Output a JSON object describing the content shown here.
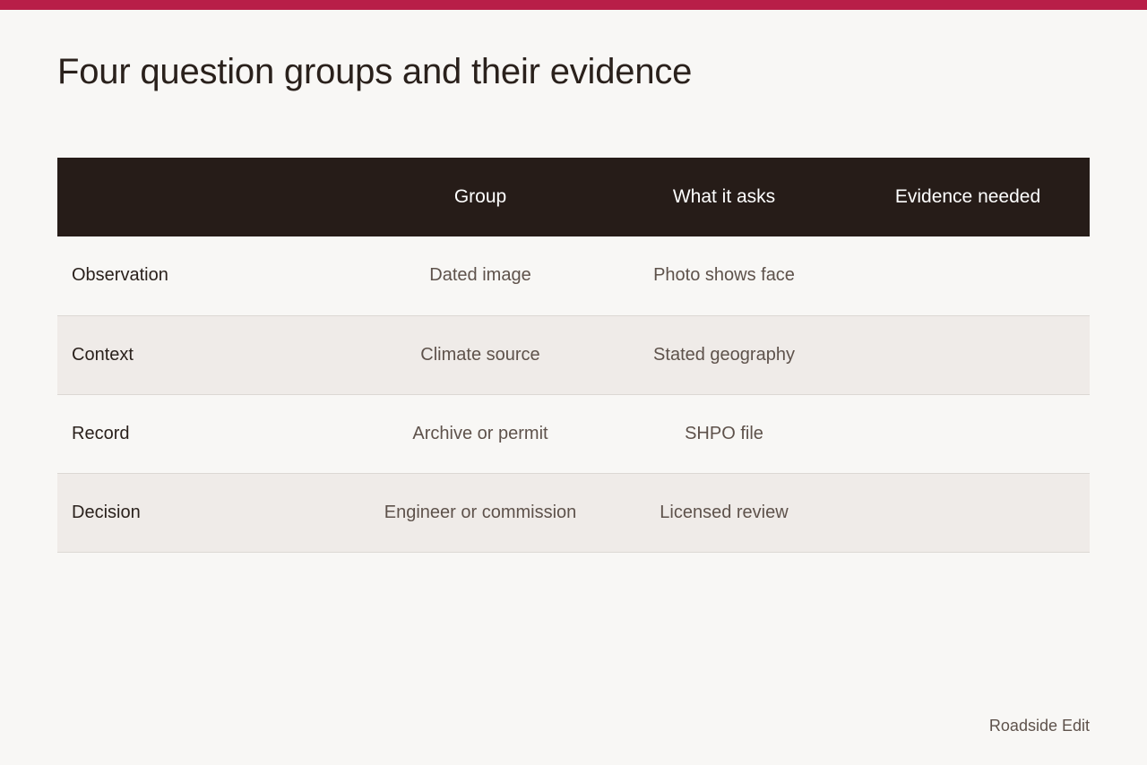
{
  "title": "Four question groups and their evidence",
  "table": {
    "headers": [
      "",
      "Group",
      "What it asks",
      "Evidence needed"
    ],
    "rows": [
      {
        "label": "Observation",
        "group": "Dated image",
        "asks": "Photo shows face",
        "evidence": ""
      },
      {
        "label": "Context",
        "group": "Climate source",
        "asks": "Stated geography",
        "evidence": ""
      },
      {
        "label": "Record",
        "group": "Archive or permit",
        "asks": "SHPO file",
        "evidence": ""
      },
      {
        "label": "Decision",
        "group": "Engineer or commission",
        "asks": "Licensed review",
        "evidence": ""
      }
    ]
  },
  "footer": {
    "brand": "Roadside Edit"
  },
  "colors": {
    "accent": "#b81e48",
    "header_bg": "#261c18",
    "background": "#f8f7f5",
    "row_alt": "#efebe8"
  }
}
